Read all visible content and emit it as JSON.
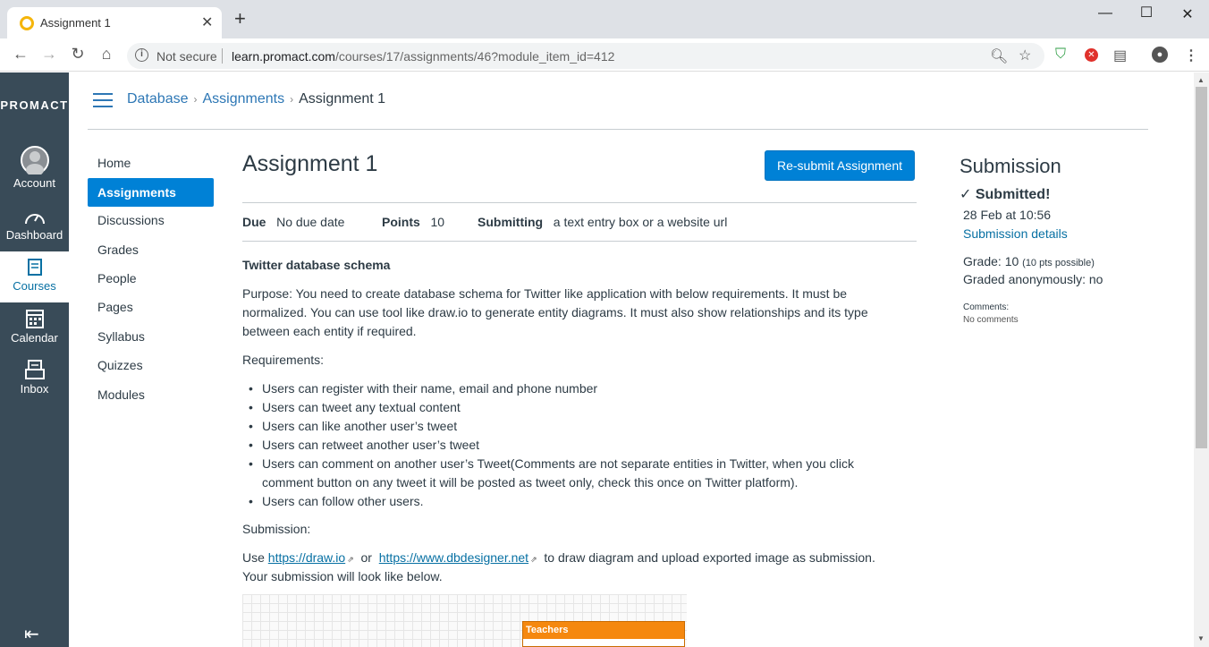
{
  "browser": {
    "tab_title": "Assignment 1",
    "not_secure": "Not secure",
    "url_host": "learn.promact.com",
    "url_path": "/courses/17/assignments/46?module_item_id=412"
  },
  "global_nav": {
    "logo": "PROMACT",
    "items": [
      {
        "label": "Account",
        "icon": "avatar-icon"
      },
      {
        "label": "Dashboard",
        "icon": "dashboard-icon"
      },
      {
        "label": "Courses",
        "icon": "courses-icon"
      },
      {
        "label": "Calendar",
        "icon": "calendar-icon"
      },
      {
        "label": "Inbox",
        "icon": "inbox-icon"
      }
    ]
  },
  "breadcrumb": [
    "Database",
    "Assignments",
    "Assignment 1"
  ],
  "course_nav": [
    "Home",
    "Assignments",
    "Discussions",
    "Grades",
    "People",
    "Pages",
    "Syllabus",
    "Quizzes",
    "Modules"
  ],
  "assignment": {
    "title": "Assignment 1",
    "resubmit_label": "Re-submit Assignment",
    "due_label": "Due",
    "due_value": "No due date",
    "points_label": "Points",
    "points_value": "10",
    "submitting_label": "Submitting",
    "submitting_value": "a text entry box or a website url",
    "heading": "Twitter database schema",
    "purpose_line1": "Purpose: You need to create database schema for Twitter like application with below requirements. It must be",
    "purpose_line2": "normalized. You can use tool like draw.io to generate entity diagrams. It must also show relationships and its type",
    "purpose_line3": "between each entity if required.",
    "requirements_label": "Requirements:",
    "requirements": [
      "Users can register with their name, email and phone number",
      "Users can tweet any textual content",
      "Users can like another user’s tweet",
      "Users can retweet another user’s tweet",
      "Users can comment on another user’s Tweet(Comments are not separate entities in Twitter, when you click",
      "comment button on any tweet it will be posted as tweet only, check this once on Twitter platform).",
      "Users can follow other users."
    ],
    "submission_label": "Submission:",
    "use_text": "Use",
    "link1": "https://draw.io",
    "or_text": "or",
    "link2": "https://www.dbdesigner.net",
    "use_rest": "to draw diagram and upload exported image as submission.",
    "look_like": "Your submission will look like below.",
    "diagram_table": "Teachers"
  },
  "submission": {
    "heading": "Submission",
    "status": "Submitted!",
    "date": "28 Feb at 10:56",
    "details_link": "Submission details",
    "grade_label": "Grade: 10",
    "grade_possible": "(10 pts possible)",
    "graded_anon": "Graded anonymously: no",
    "comments_label": "Comments:",
    "comments_value": "No comments"
  }
}
